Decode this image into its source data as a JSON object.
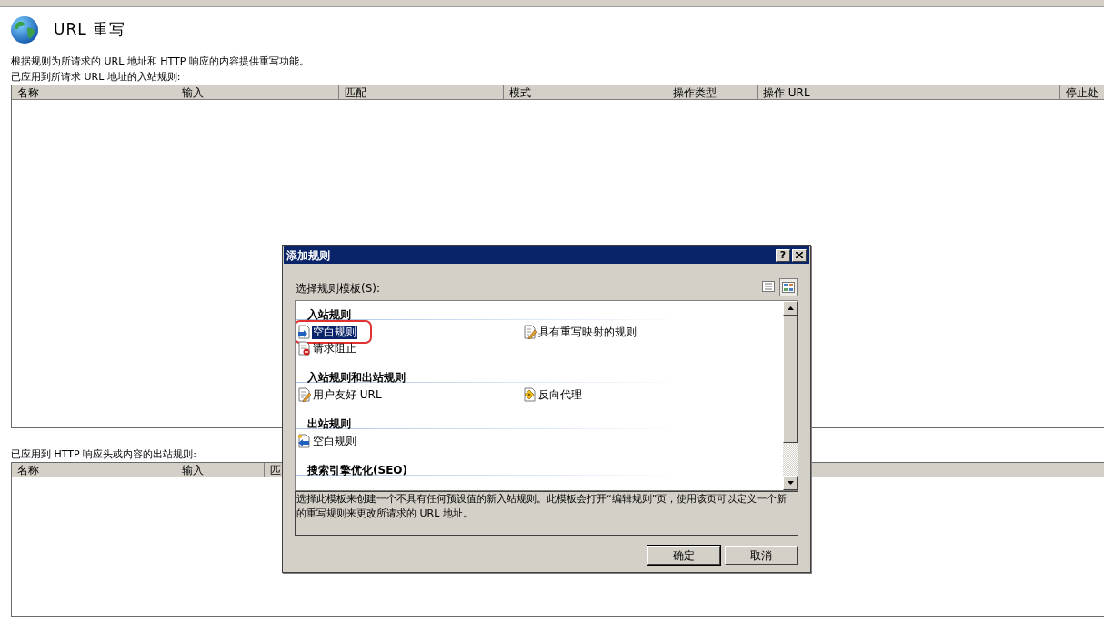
{
  "page": {
    "title": "URL 重写",
    "description": "根据规则为所请求的 URL 地址和 HTTP 响应的内容提供重写功能。",
    "inbound_label": "已应用到所请求 URL 地址的入站规则:",
    "inbound_table": {
      "columns": [
        "名称",
        "输入",
        "匹配",
        "模式",
        "操作类型",
        "操作 URL",
        "停止处"
      ]
    },
    "outbound_label": "已应用到 HTTP 响应头或内容的出站规则:",
    "outbound_table": {
      "columns": [
        "名称",
        "输入",
        "匹"
      ]
    }
  },
  "dialog": {
    "title": "添加规则",
    "help_button": "?",
    "template_label": "选择规则模板(S):",
    "sections": [
      {
        "heading": "入站规则",
        "items": [
          {
            "label": "空白规则",
            "kind": "blank_inbound",
            "selected": true,
            "annotated": true
          },
          {
            "label": "具有重写映射的规则",
            "kind": "pencil_doc",
            "selected": false,
            "annotated": false
          },
          {
            "label": "请求阻止",
            "kind": "block_doc",
            "selected": false,
            "annotated": false
          }
        ]
      },
      {
        "heading": "入站规则和出站规则",
        "items": [
          {
            "label": "用户友好 URL",
            "kind": "pencil_doc",
            "selected": false,
            "annotated": false
          },
          {
            "label": "反向代理",
            "kind": "proxy_doc",
            "selected": false,
            "annotated": false
          }
        ]
      },
      {
        "heading": "出站规则",
        "items": [
          {
            "label": "空白规则",
            "kind": "blank_outbound",
            "selected": false,
            "annotated": false
          }
        ]
      },
      {
        "heading": "搜索引擎优化(SEO)"
      }
    ],
    "description": "选择此模板来创建一个不具有任何预设值的新入站规则。此模板会打开“编辑规则”页，使用该页可以定义一个新的重写规则来更改所请求的 URL 地址。",
    "buttons": [
      "确定",
      "取消"
    ]
  }
}
